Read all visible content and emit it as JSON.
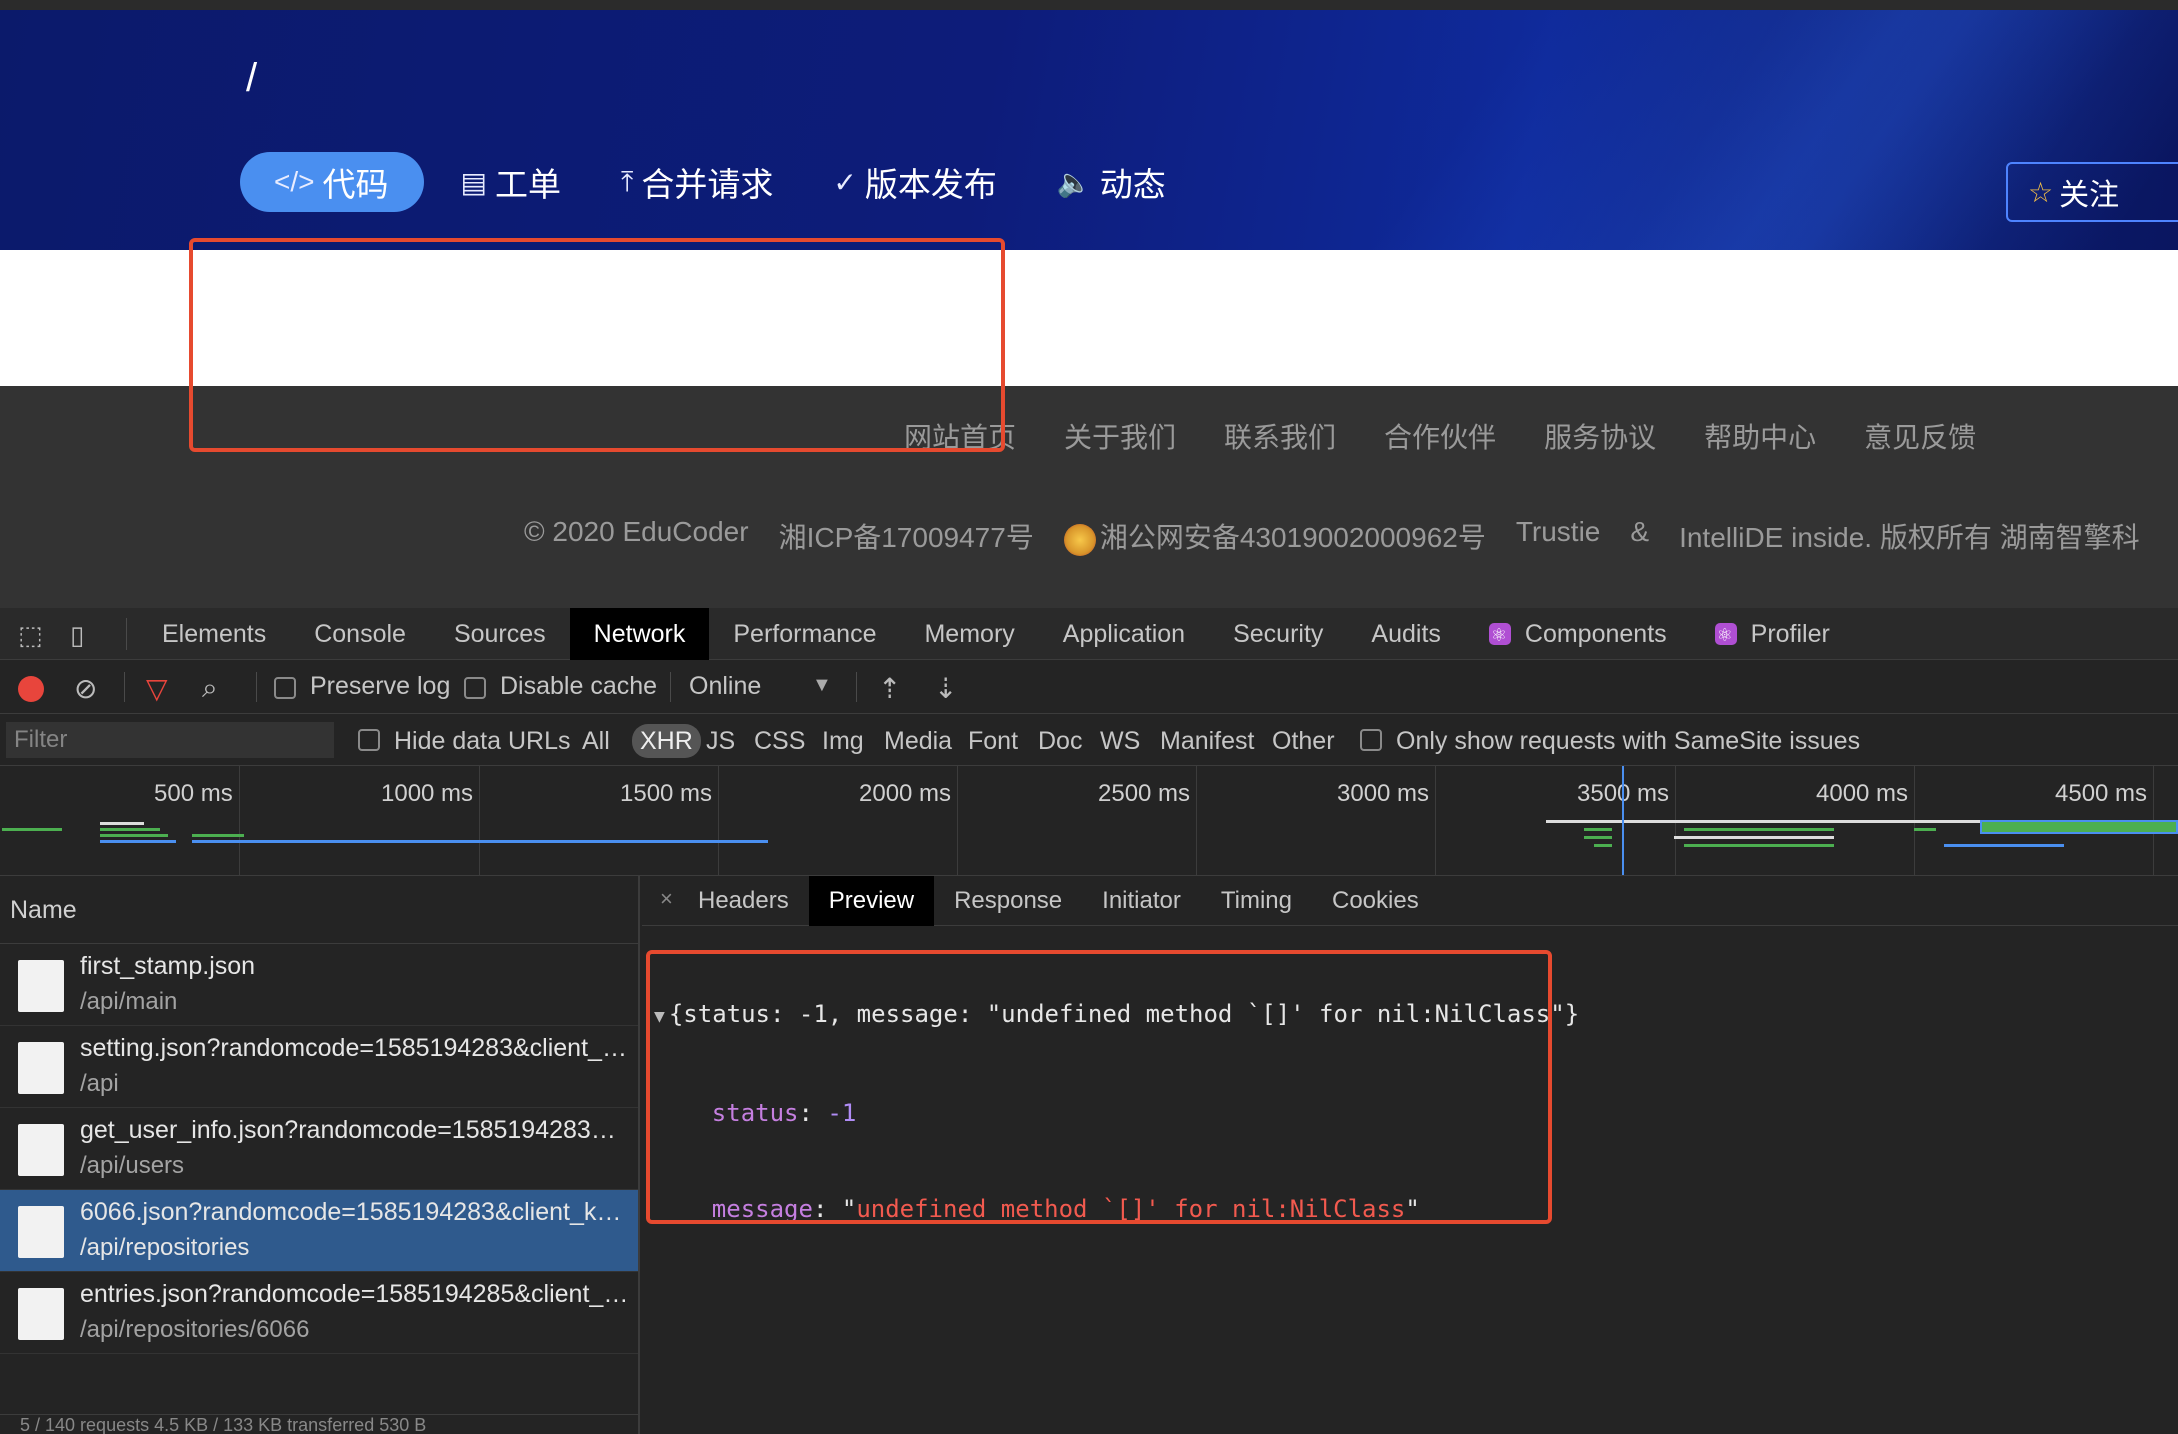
{
  "site": {
    "repo_path": "/",
    "nav": [
      {
        "label": "代码",
        "icon": "code-icon",
        "glyph": "</>"
      },
      {
        "label": "工单",
        "icon": "clipboard-icon",
        "glyph": "▤"
      },
      {
        "label": "合并请求",
        "icon": "merge-icon",
        "glyph": "⤒"
      },
      {
        "label": "版本发布",
        "icon": "check-circle-icon",
        "glyph": "✓"
      },
      {
        "label": "动态",
        "icon": "speaker-icon",
        "glyph": "🔈"
      }
    ],
    "follow_label": "关注",
    "footer_links": [
      "网站首页",
      "关于我们",
      "联系我们",
      "合作伙伴",
      "服务协议",
      "帮助中心",
      "意见反馈"
    ],
    "footer_copy": {
      "copyright": "© 2020 EduCoder",
      "icp": "湘ICP备17009477号",
      "police": "湘公网安备43019002000962号",
      "trustie": "Trustie",
      "amp": "&",
      "rest": "IntelliDE inside. 版权所有 湖南智擎科"
    }
  },
  "devtools": {
    "tabs": [
      "Elements",
      "Console",
      "Sources",
      "Network",
      "Performance",
      "Memory",
      "Application",
      "Security",
      "Audits"
    ],
    "react_tabs": [
      "Components",
      "Profiler"
    ],
    "active_tab": "Network",
    "toolbar": {
      "preserve_log": "Preserve log",
      "disable_cache": "Disable cache",
      "throttle": "Online"
    },
    "filter": {
      "placeholder": "Filter",
      "hide_data_urls": "Hide data URLs",
      "types": [
        "All",
        "XHR",
        "JS",
        "CSS",
        "Img",
        "Media",
        "Font",
        "Doc",
        "WS",
        "Manifest",
        "Other"
      ],
      "active_type": "XHR",
      "samesite": "Only show requests with SameSite issues"
    },
    "timeline_labels": [
      "500 ms",
      "1000 ms",
      "1500 ms",
      "2000 ms",
      "2500 ms",
      "3000 ms",
      "3500 ms",
      "4000 ms",
      "4500 ms"
    ],
    "name_header": "Name",
    "requests": [
      {
        "name": "first_stamp.json",
        "path": "/api/main"
      },
      {
        "name": "setting.json?randomcode=1585194283&client_k…",
        "path": "/api"
      },
      {
        "name": "get_user_info.json?randomcode=1585194283&c…",
        "path": "/api/users"
      },
      {
        "name": "6066.json?randomcode=1585194283&client_key…",
        "path": "/api/repositories"
      },
      {
        "name": "entries.json?randomcode=1585194285&client_k…",
        "path": "/api/repositories/6066"
      }
    ],
    "selected_index": 3,
    "status_bar": "5 / 140 requests   4.5 KB / 133 KB transferred   530 B",
    "detail_close": "×",
    "detail_tabs": [
      "Headers",
      "Preview",
      "Response",
      "Initiator",
      "Timing",
      "Cookies"
    ],
    "active_detail_tab": "Preview",
    "preview": {
      "summary": "{status: -1, message: \"undefined method `[]' for nil:NilClass\"}",
      "status_key": "status",
      "status_value": "-1",
      "message_key": "message",
      "message_value": "undefined method `[]' for nil:NilClass"
    }
  },
  "colors": {
    "accent": "#4a8ff0",
    "highlight": "#e64a2f",
    "record": "#e8453c",
    "selected_row": "#2f5a8d"
  }
}
